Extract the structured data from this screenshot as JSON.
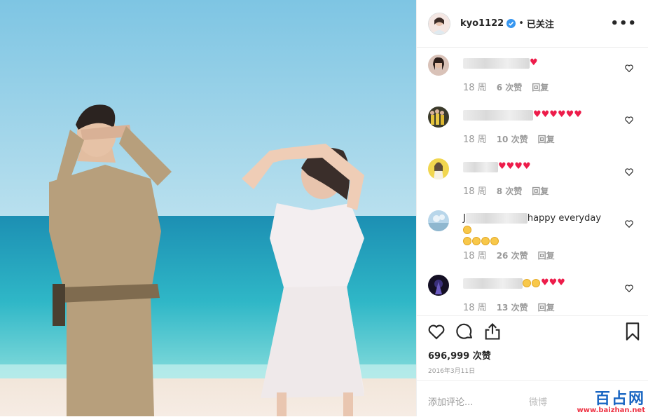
{
  "header": {
    "username": "kyo1122",
    "separator": "•",
    "follow_label": "已关注",
    "more_label": "•••"
  },
  "comments": [
    {
      "suffix": "♥",
      "time": "18 周",
      "likes": "6 次赞",
      "reply": "回复"
    },
    {
      "suffix": "♥♥♥♥♥♥",
      "time": "18 周",
      "likes": "10 次赞",
      "reply": "回复"
    },
    {
      "suffix": "♥♥♥♥",
      "time": "18 周",
      "likes": "8 次赞",
      "reply": "回复"
    },
    {
      "prefix": "J",
      "suffix": "happy everyday",
      "time": "18 周",
      "likes": "26 次赞",
      "reply": "回复"
    },
    {
      "suffix": "♥♥♥",
      "time": "18 周",
      "likes": "13 次赞",
      "reply": "回复"
    }
  ],
  "post": {
    "like_count": "696,999 次赞",
    "date": "2016年3月11日"
  },
  "add_comment_placeholder": "添加评论...",
  "watermark": {
    "weibo": "微博",
    "site_name": "百占网",
    "site_url": "www.baizhan.net"
  },
  "colors": {
    "heart": "#ed1c4a",
    "verified": "#3897f0",
    "watermark_blue": "#1a66c2"
  },
  "icons": [
    "verified-icon",
    "more-icon",
    "heart-icon",
    "comment-icon",
    "share-icon",
    "bookmark-icon"
  ]
}
